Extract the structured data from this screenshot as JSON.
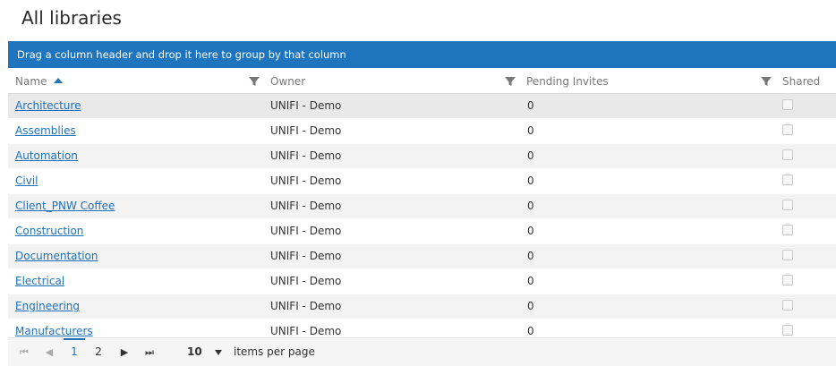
{
  "page": {
    "title": "All libraries"
  },
  "group_bar": {
    "text": "Drag a column header and drop it here to group by that column"
  },
  "columns": {
    "name": "Name",
    "owner": "Owner",
    "pending": "Pending Invites",
    "shared": "Shared"
  },
  "rows": [
    {
      "name": "Architecture",
      "owner": "UNIFI - Demo",
      "pending": "0",
      "shared": false
    },
    {
      "name": "Assemblies",
      "owner": "UNIFI - Demo",
      "pending": "0",
      "shared": false
    },
    {
      "name": "Automation",
      "owner": "UNIFI - Demo",
      "pending": "0",
      "shared": false
    },
    {
      "name": "Civil",
      "owner": "UNIFI - Demo",
      "pending": "0",
      "shared": false
    },
    {
      "name": "Client_PNW Coffee",
      "owner": "UNIFI - Demo",
      "pending": "0",
      "shared": false
    },
    {
      "name": "Construction",
      "owner": "UNIFI - Demo",
      "pending": "0",
      "shared": false
    },
    {
      "name": "Documentation",
      "owner": "UNIFI - Demo",
      "pending": "0",
      "shared": false
    },
    {
      "name": "Electrical",
      "owner": "UNIFI - Demo",
      "pending": "0",
      "shared": false
    },
    {
      "name": "Engineering",
      "owner": "UNIFI - Demo",
      "pending": "0",
      "shared": false
    },
    {
      "name": "Manufacturers",
      "owner": "UNIFI - Demo",
      "pending": "0",
      "shared": false
    }
  ],
  "pager": {
    "pages": [
      "1",
      "2"
    ],
    "current": "1",
    "page_size": "10",
    "items_per_page": "items per page"
  },
  "colors": {
    "accent": "#1e74bd",
    "link": "#1e6fb8"
  }
}
